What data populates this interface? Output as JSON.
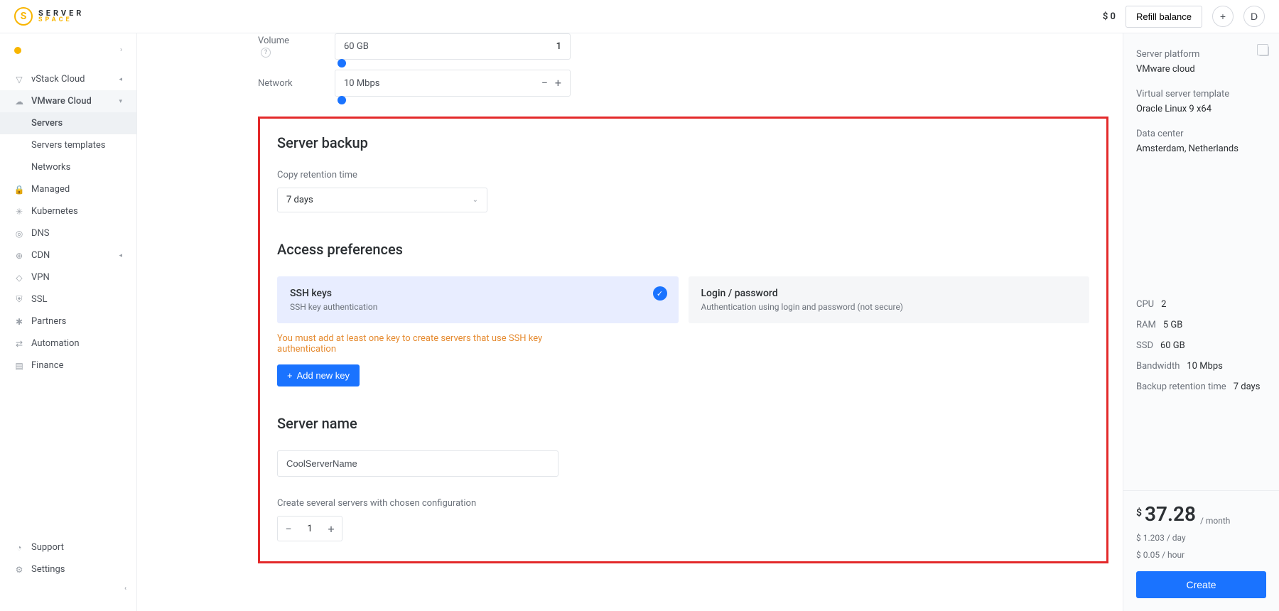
{
  "brand": {
    "top": "SERVER",
    "bot": "SPACE"
  },
  "top": {
    "balance": "$ 0",
    "refill": "Refill balance",
    "avatar_letter": "D"
  },
  "sidebar": {
    "project_menu_icon": "›",
    "items": [
      {
        "label": "vStack Cloud",
        "icon": "▽",
        "expand": "◂"
      },
      {
        "label": "VMware Cloud",
        "icon": "☁",
        "expand": "▾"
      }
    ],
    "vmware_sub": [
      {
        "label": "Servers"
      },
      {
        "label": "Servers templates"
      },
      {
        "label": "Networks"
      }
    ],
    "rest": [
      {
        "label": "Managed",
        "icon": "🔒"
      },
      {
        "label": "Kubernetes",
        "icon": "✳"
      },
      {
        "label": "DNS",
        "icon": "◎"
      },
      {
        "label": "CDN",
        "icon": "⊕",
        "expand": "◂"
      },
      {
        "label": "VPN",
        "icon": "◇"
      },
      {
        "label": "SSL",
        "icon": "⛨"
      },
      {
        "label": "Partners",
        "icon": "✱"
      },
      {
        "label": "Automation",
        "icon": "⇄"
      },
      {
        "label": "Finance",
        "icon": "▤"
      }
    ],
    "bottom": [
      {
        "label": "Support",
        "icon": "◔"
      },
      {
        "label": "Settings",
        "icon": "⚙"
      }
    ],
    "collapse": "‹"
  },
  "sliders": {
    "volume": {
      "label": "Volume",
      "value": "60 GB",
      "right": "1"
    },
    "network": {
      "label": "Network",
      "value": "10 Mbps"
    }
  },
  "backup": {
    "title": "Server backup",
    "retention_label": "Copy retention time",
    "retention_value": "7 days"
  },
  "access": {
    "title": "Access preferences",
    "ssh": {
      "title": "SSH keys",
      "sub": "SSH key authentication"
    },
    "login": {
      "title": "Login / password",
      "sub": "Authentication using login and password (not secure)"
    },
    "warn": "You must add at least one key to create servers that use SSH key authentication",
    "add_btn": "Add new key"
  },
  "server_name": {
    "title": "Server name",
    "value": "CoolServerName",
    "count_note": "Create several servers with chosen configuration",
    "count": "1"
  },
  "summary": {
    "platform_label": "Server platform",
    "platform": "VMware cloud",
    "template_label": "Virtual server template",
    "template": "Oracle Linux 9 x64",
    "dc_label": "Data center",
    "dc": "Amsterdam, Netherlands",
    "specs": {
      "cpu_k": "CPU",
      "cpu_v": "2",
      "ram_k": "RAM",
      "ram_v": "5 GB",
      "ssd_k": "SSD",
      "ssd_v": "60 GB",
      "bw_k": "Bandwidth",
      "bw_v": "10 Mbps",
      "brt_k": "Backup retention time",
      "brt_v": "7 days"
    },
    "price": {
      "cur": "$",
      "amount": "37.28",
      "per": "/ month"
    },
    "price_day": "$ 1.203 / day",
    "price_hour": "$ 0.05 / hour",
    "create": "Create"
  }
}
